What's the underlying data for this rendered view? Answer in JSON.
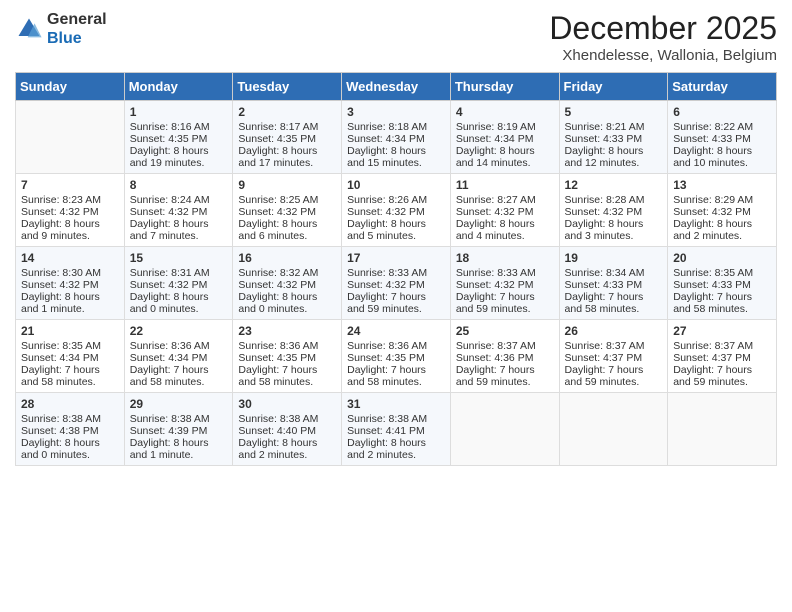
{
  "logo": {
    "general": "General",
    "blue": "Blue"
  },
  "title": "December 2025",
  "subtitle": "Xhendelesse, Wallonia, Belgium",
  "days_of_week": [
    "Sunday",
    "Monday",
    "Tuesday",
    "Wednesday",
    "Thursday",
    "Friday",
    "Saturday"
  ],
  "weeks": [
    [
      {
        "day": "",
        "content": ""
      },
      {
        "day": "1",
        "content": "Sunrise: 8:16 AM\nSunset: 4:35 PM\nDaylight: 8 hours\nand 19 minutes."
      },
      {
        "day": "2",
        "content": "Sunrise: 8:17 AM\nSunset: 4:35 PM\nDaylight: 8 hours\nand 17 minutes."
      },
      {
        "day": "3",
        "content": "Sunrise: 8:18 AM\nSunset: 4:34 PM\nDaylight: 8 hours\nand 15 minutes."
      },
      {
        "day": "4",
        "content": "Sunrise: 8:19 AM\nSunset: 4:34 PM\nDaylight: 8 hours\nand 14 minutes."
      },
      {
        "day": "5",
        "content": "Sunrise: 8:21 AM\nSunset: 4:33 PM\nDaylight: 8 hours\nand 12 minutes."
      },
      {
        "day": "6",
        "content": "Sunrise: 8:22 AM\nSunset: 4:33 PM\nDaylight: 8 hours\nand 10 minutes."
      }
    ],
    [
      {
        "day": "7",
        "content": "Sunrise: 8:23 AM\nSunset: 4:32 PM\nDaylight: 8 hours\nand 9 minutes."
      },
      {
        "day": "8",
        "content": "Sunrise: 8:24 AM\nSunset: 4:32 PM\nDaylight: 8 hours\nand 7 minutes."
      },
      {
        "day": "9",
        "content": "Sunrise: 8:25 AM\nSunset: 4:32 PM\nDaylight: 8 hours\nand 6 minutes."
      },
      {
        "day": "10",
        "content": "Sunrise: 8:26 AM\nSunset: 4:32 PM\nDaylight: 8 hours\nand 5 minutes."
      },
      {
        "day": "11",
        "content": "Sunrise: 8:27 AM\nSunset: 4:32 PM\nDaylight: 8 hours\nand 4 minutes."
      },
      {
        "day": "12",
        "content": "Sunrise: 8:28 AM\nSunset: 4:32 PM\nDaylight: 8 hours\nand 3 minutes."
      },
      {
        "day": "13",
        "content": "Sunrise: 8:29 AM\nSunset: 4:32 PM\nDaylight: 8 hours\nand 2 minutes."
      }
    ],
    [
      {
        "day": "14",
        "content": "Sunrise: 8:30 AM\nSunset: 4:32 PM\nDaylight: 8 hours\nand 1 minute."
      },
      {
        "day": "15",
        "content": "Sunrise: 8:31 AM\nSunset: 4:32 PM\nDaylight: 8 hours\nand 0 minutes."
      },
      {
        "day": "16",
        "content": "Sunrise: 8:32 AM\nSunset: 4:32 PM\nDaylight: 8 hours\nand 0 minutes."
      },
      {
        "day": "17",
        "content": "Sunrise: 8:33 AM\nSunset: 4:32 PM\nDaylight: 7 hours\nand 59 minutes."
      },
      {
        "day": "18",
        "content": "Sunrise: 8:33 AM\nSunset: 4:32 PM\nDaylight: 7 hours\nand 59 minutes."
      },
      {
        "day": "19",
        "content": "Sunrise: 8:34 AM\nSunset: 4:33 PM\nDaylight: 7 hours\nand 58 minutes."
      },
      {
        "day": "20",
        "content": "Sunrise: 8:35 AM\nSunset: 4:33 PM\nDaylight: 7 hours\nand 58 minutes."
      }
    ],
    [
      {
        "day": "21",
        "content": "Sunrise: 8:35 AM\nSunset: 4:34 PM\nDaylight: 7 hours\nand 58 minutes."
      },
      {
        "day": "22",
        "content": "Sunrise: 8:36 AM\nSunset: 4:34 PM\nDaylight: 7 hours\nand 58 minutes."
      },
      {
        "day": "23",
        "content": "Sunrise: 8:36 AM\nSunset: 4:35 PM\nDaylight: 7 hours\nand 58 minutes."
      },
      {
        "day": "24",
        "content": "Sunrise: 8:36 AM\nSunset: 4:35 PM\nDaylight: 7 hours\nand 58 minutes."
      },
      {
        "day": "25",
        "content": "Sunrise: 8:37 AM\nSunset: 4:36 PM\nDaylight: 7 hours\nand 59 minutes."
      },
      {
        "day": "26",
        "content": "Sunrise: 8:37 AM\nSunset: 4:37 PM\nDaylight: 7 hours\nand 59 minutes."
      },
      {
        "day": "27",
        "content": "Sunrise: 8:37 AM\nSunset: 4:37 PM\nDaylight: 7 hours\nand 59 minutes."
      }
    ],
    [
      {
        "day": "28",
        "content": "Sunrise: 8:38 AM\nSunset: 4:38 PM\nDaylight: 8 hours\nand 0 minutes."
      },
      {
        "day": "29",
        "content": "Sunrise: 8:38 AM\nSunset: 4:39 PM\nDaylight: 8 hours\nand 1 minute."
      },
      {
        "day": "30",
        "content": "Sunrise: 8:38 AM\nSunset: 4:40 PM\nDaylight: 8 hours\nand 2 minutes."
      },
      {
        "day": "31",
        "content": "Sunrise: 8:38 AM\nSunset: 4:41 PM\nDaylight: 8 hours\nand 2 minutes."
      },
      {
        "day": "",
        "content": ""
      },
      {
        "day": "",
        "content": ""
      },
      {
        "day": "",
        "content": ""
      }
    ]
  ]
}
